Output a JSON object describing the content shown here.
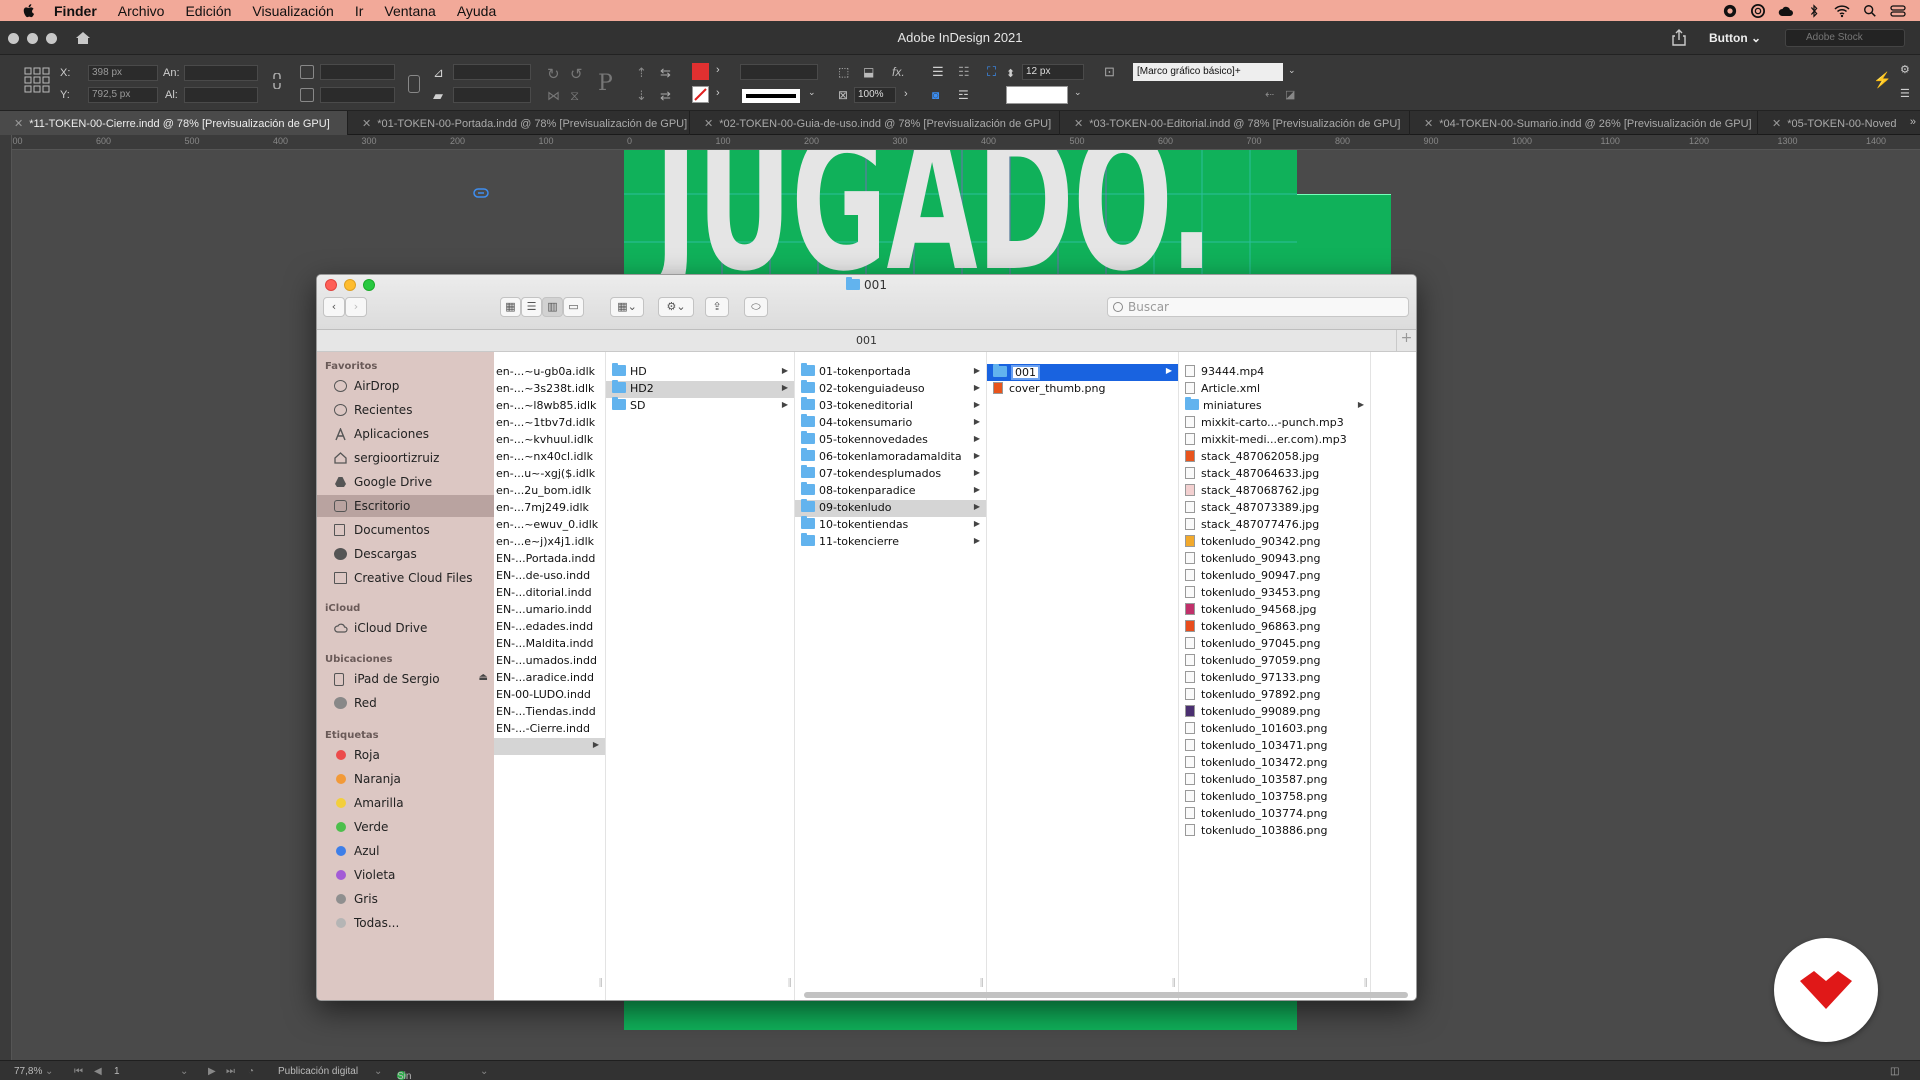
{
  "menubar": {
    "items": [
      "Finder",
      "Archivo",
      "Edición",
      "Visualización",
      "Ir",
      "Ventana",
      "Ayuda"
    ]
  },
  "app": {
    "title": "Adobe InDesign 2021",
    "workspace": "Button",
    "stock_placeholder": "Adobe Stock"
  },
  "controlbar": {
    "x_label": "X:",
    "x_value": "398 px",
    "y_label": "Y:",
    "y_value": "792,5 px",
    "w_label": "An:",
    "h_label": "Al:",
    "scale": "100%",
    "stroke_weight": "12 px",
    "object_style": "[Marco gráfico básico]+"
  },
  "tabs": [
    "*11-TOKEN-00-Cierre.indd @ 78% [Previsualización de GPU]",
    "*01-TOKEN-00-Portada.indd @ 78% [Previsualización de GPU]",
    "*02-TOKEN-00-Guia-de-uso.indd @ 78% [Previsualización de GPU]",
    "*03-TOKEN-00-Editorial.indd @ 78% [Previsualización de GPU]",
    "*04-TOKEN-00-Sumario.indd @ 26% [Previsualización de GPU]",
    "*05-TOKEN-00-Noved"
  ],
  "ruler": {
    "h": [
      "700",
      "600",
      "500",
      "400",
      "300",
      "200",
      "100",
      "0",
      "100",
      "200",
      "300",
      "400",
      "500",
      "600",
      "700",
      "800",
      "900",
      "1000",
      "1100",
      "1200",
      "1300",
      "1400"
    ]
  },
  "page": {
    "headline": "JUGADO."
  },
  "statusbar": {
    "zoom": "77,8%",
    "page": "1",
    "preflight_profile": "Publicación digital",
    "errors": "Sin errores"
  },
  "finder": {
    "title": "001",
    "path_title": "001",
    "search_placeholder": "Buscar",
    "sidebar": {
      "favorites_header": "Favoritos",
      "favorites": [
        "AirDrop",
        "Recientes",
        "Aplicaciones",
        "sergioortizruiz",
        "Google Drive",
        "Escritorio",
        "Documentos",
        "Descargas",
        "Creative Cloud Files"
      ],
      "icloud_header": "iCloud",
      "icloud": [
        "iCloud Drive"
      ],
      "locations_header": "Ubicaciones",
      "locations": [
        "iPad de Sergio",
        "Red"
      ],
      "tags_header": "Etiquetas",
      "tags": [
        {
          "label": "Roja",
          "color": "#ec4b4b"
        },
        {
          "label": "Naranja",
          "color": "#f29a38"
        },
        {
          "label": "Amarilla",
          "color": "#f3cf3c"
        },
        {
          "label": "Verde",
          "color": "#4cbf4c"
        },
        {
          "label": "Azul",
          "color": "#3d7ee8"
        },
        {
          "label": "Violeta",
          "color": "#a35bd6"
        },
        {
          "label": "Gris",
          "color": "#8f8f8f"
        },
        {
          "label": "Todas...",
          "color": "#b5b5b5"
        }
      ]
    },
    "col0": [
      "en-...~u-gb0a.idlk",
      "en-...~3s238t.idlk",
      "en-...~l8wb85.idlk",
      "en-...~1tbv7d.idlk",
      "en-...~kvhuul.idlk",
      "en-...~nx40cl.idlk",
      "en-...u~-xgj($.idlk",
      "en-...2u_bom.idlk",
      "en-...7mj249.idlk",
      "en-...~ewuv_0.idlk",
      "en-...e~j)x4j1.idlk",
      "EN-...Portada.indd",
      "EN-...de-uso.indd",
      "EN-...ditorial.indd",
      "EN-...umario.indd",
      "EN-...edades.indd",
      "EN-...Maldita.indd",
      "EN-...umados.indd",
      "EN-...aradice.indd",
      "EN-00-LUDO.indd",
      "EN-...Tiendas.indd",
      "EN-...-Cierre.indd"
    ],
    "col1": [
      "HD",
      "HD2",
      "SD"
    ],
    "col2": [
      "01-tokenportada",
      "02-tokenguiadeuso",
      "03-tokeneditorial",
      "04-tokensumario",
      "05-tokennovedades",
      "06-tokenlamoradamaldita",
      "07-tokendesplumados",
      "08-tokenparadice",
      "09-tokenludo",
      "10-tokentiendas",
      "11-tokencierre"
    ],
    "col3": [
      "001",
      "cover_thumb.png"
    ],
    "col4": [
      "93444.mp4",
      "Article.xml",
      "miniatures",
      "mixkit-carto...-punch.mp3",
      "mixkit-medi...er.com).mp3",
      "stack_487062058.jpg",
      "stack_487064633.jpg",
      "stack_487068762.jpg",
      "stack_487073389.jpg",
      "stack_487077476.jpg",
      "tokenludo_90342.png",
      "tokenludo_90943.png",
      "tokenludo_90947.png",
      "tokenludo_93453.png",
      "tokenludo_94568.jpg",
      "tokenludo_96863.png",
      "tokenludo_97045.png",
      "tokenludo_97059.png",
      "tokenludo_97133.png",
      "tokenludo_97892.png",
      "tokenludo_99089.png",
      "tokenludo_101603.png",
      "tokenludo_103471.png",
      "tokenludo_103472.png",
      "tokenludo_103587.png",
      "tokenludo_103758.png",
      "tokenludo_103774.png",
      "tokenludo_103886.png"
    ]
  },
  "colors": {
    "menubar": "#f2a999",
    "page_green": "#10b15a",
    "selection_blue": "#1963e0",
    "sidebar": "#dcc7c3",
    "brand_red": "#e01818"
  }
}
